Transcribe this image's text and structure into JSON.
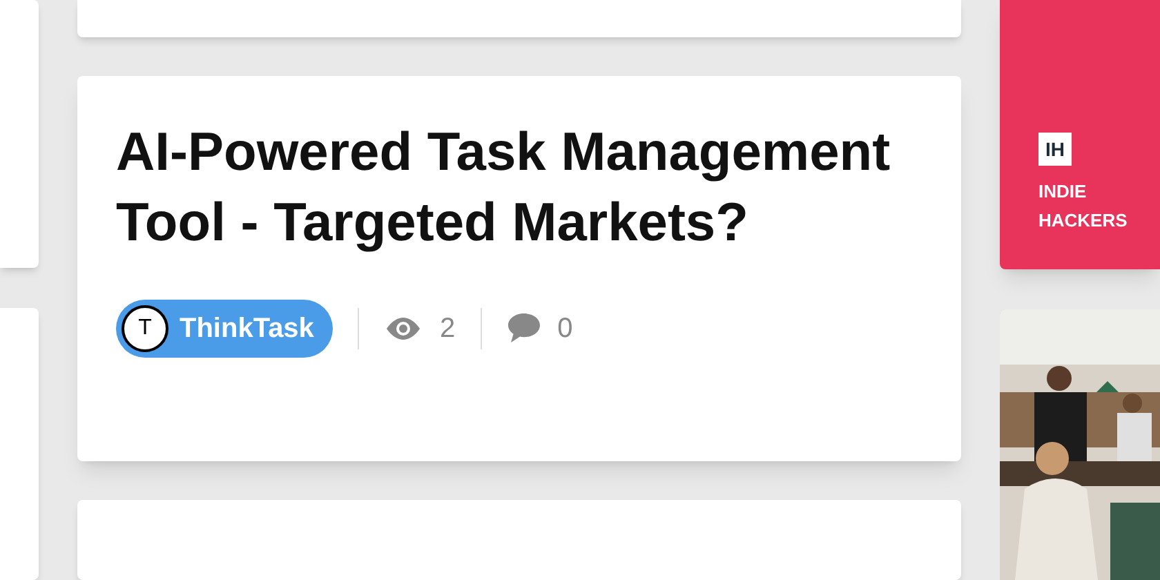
{
  "post": {
    "title": "AI-Powered Task Management Tool - Targeted Markets?",
    "group": {
      "initial": "T",
      "name": "ThinkTask"
    },
    "views": "2",
    "comments": "0"
  },
  "sponsor": {
    "logo": "IH",
    "name": "INDIE HACKERS"
  }
}
